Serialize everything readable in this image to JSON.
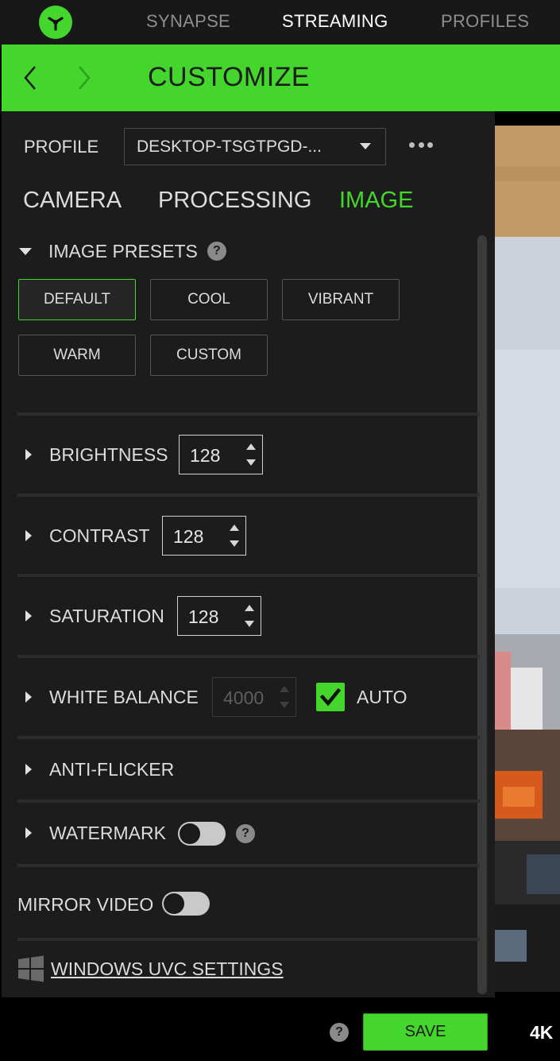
{
  "topnav": {
    "tabs": [
      "SYNAPSE",
      "STREAMING",
      "PROFILES"
    ],
    "active_tab": "STREAMING"
  },
  "header": {
    "title": "CUSTOMIZE"
  },
  "profile": {
    "label": "PROFILE",
    "value": "DESKTOP-TSGTPGD-..."
  },
  "subtabs": [
    "CAMERA",
    "PROCESSING",
    "IMAGE"
  ],
  "active_subtab": "IMAGE",
  "image_presets": {
    "title": "IMAGE PRESETS",
    "help": "?",
    "presets": [
      "DEFAULT",
      "COOL",
      "VIBRANT",
      "WARM",
      "CUSTOM"
    ],
    "selected": "DEFAULT"
  },
  "brightness": {
    "label": "BRIGHTNESS",
    "value": "128"
  },
  "contrast": {
    "label": "CONTRAST",
    "value": "128"
  },
  "saturation": {
    "label": "SATURATION",
    "value": "128"
  },
  "white_balance": {
    "label": "WHITE BALANCE",
    "value": "4000",
    "auto_label": "AUTO",
    "auto_checked": true
  },
  "anti_flicker": {
    "label": "ANTI-FLICKER"
  },
  "watermark": {
    "label": "WATERMARK",
    "help": "?",
    "enabled": false
  },
  "mirror_video": {
    "label": "MIRROR VIDEO",
    "enabled": false
  },
  "windows_uvc": {
    "label": "WINDOWS UVC SETTINGS"
  },
  "bottom": {
    "help": "?",
    "save_label": "SAVE",
    "resolution": "4K"
  },
  "colors": {
    "accent": "#44d62c",
    "panel": "#1c1c1c",
    "topnav": "#181818"
  }
}
